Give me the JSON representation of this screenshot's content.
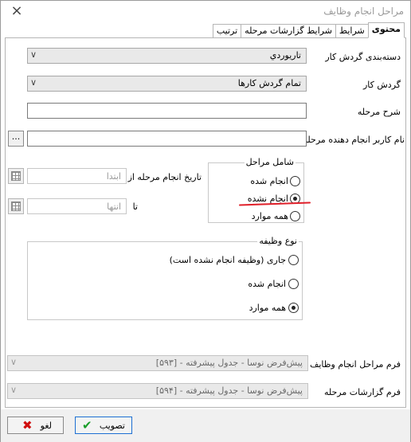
{
  "window": {
    "title": "مراحل انجام وظایف",
    "close_icon": "×"
  },
  "tabs": [
    {
      "label": "محتوی",
      "active": true
    },
    {
      "label": "شرایط",
      "active": false
    },
    {
      "label": "شرایط گزارشات مرحله",
      "active": false
    },
    {
      "label": "ترتیب",
      "active": false
    }
  ],
  "form": {
    "category_label": "دسته‌بندی گردش کار",
    "category_value": "تاریوردي",
    "workflow_label": "گردش کار",
    "workflow_value": "تمام گردش کارها",
    "stage_desc_label": "شرح مرحله",
    "stage_desc_value": "",
    "user_label": "نام کاربر انجام دهنده مرحله",
    "user_value": "",
    "browse_label": "...",
    "date_from_label": "تاریخ انجام مرحله از",
    "date_from_placeholder": "ابتدا",
    "date_to_label": "تا",
    "date_to_placeholder": "انتها"
  },
  "stages_group": {
    "title": "شامل مراحل",
    "options": [
      {
        "label": "انجام شده",
        "selected": false
      },
      {
        "label": "انجام نشده",
        "selected": true
      },
      {
        "label": "همه موارد",
        "selected": false
      }
    ]
  },
  "task_type_group": {
    "title": "نوع وظیفه",
    "options": [
      {
        "label": "جاری (وظیفه انجام نشده است)",
        "selected": false
      },
      {
        "label": "انجام شده",
        "selected": false
      },
      {
        "label": "همه موارد",
        "selected": true
      }
    ]
  },
  "bottom": {
    "task_form_label": "فرم مراحل انجام وظایف",
    "task_form_value": "پیش‌فرض نوسا - جدول پیشرفته - [۵۹۳]",
    "report_form_label": "فرم گزارشات مرحله",
    "report_form_value": "پیش‌فرض نوسا - جدول پیشرفته - [۵۹۴]"
  },
  "footer": {
    "approve_label": "تصویب",
    "cancel_label": "لغو"
  },
  "colors": {
    "approve_icon": "#1a9e2a",
    "cancel_icon": "#d01010",
    "annotation": "#e0202a"
  }
}
